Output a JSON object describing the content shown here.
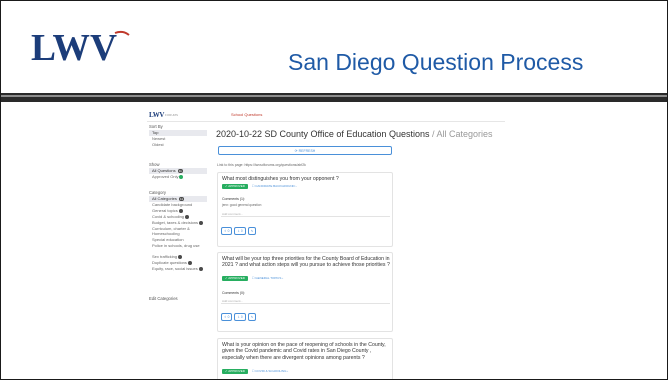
{
  "slide": {
    "title": "San Diego Question Process",
    "logo_text": "LWV"
  },
  "screenshot": {
    "topbar": {
      "logo": "LWV",
      "logo_sub": "FORUMS",
      "link": "School Questions"
    },
    "sidebar": {
      "sort_by_label": "Sort By",
      "sort_options": [
        "Top",
        "Newest",
        "Oldest"
      ],
      "show_label": "Show",
      "show_all": "All Questions",
      "show_all_count": "11",
      "show_approved": "Approved Only",
      "category_label": "Category",
      "categories": [
        "All Categories",
        "Candidate background",
        "General topics",
        "Covid & schooling",
        "Budget, taxes & decisions",
        "Curriculum, charter & Homeschooling",
        "Special education",
        "Police in schools, drug use",
        "Sex trafficking",
        "Duplicate questions",
        "Equity, race, social issues"
      ],
      "all_categories_count": "11",
      "edit_categories": "Edit Categories"
    },
    "main": {
      "title": "2020-10-22 SD County Office of Education Questions",
      "title_separator": " / ",
      "title_category": "All Categories",
      "refresh_label": "REFRESH",
      "link_label": "Link to this page:",
      "link_url": "https://lwvsdforums.org/questions/abf2k",
      "cards": [
        {
          "question": "What most distinguishes you from your opponent ?",
          "status": "APPROVED",
          "category": "CANDIDATE BACKGROUND",
          "comments_label": "Comments (1):",
          "comment": "jenn: good general question",
          "comment_placeholder": "Add comment...",
          "up_count": "0",
          "down_count": "0"
        },
        {
          "question": "What will be your top three priorities for the County Board of Education in 2021 ? and what action steps will you pursue to achieve those priorities ?",
          "status": "APPROVED",
          "category": "GENERAL TOPICS",
          "comments_label": "Comments (0):",
          "comment_placeholder": "Add comment...",
          "up_count": "0",
          "down_count": "0"
        },
        {
          "question": "What is your opinion on the pace of reopening of schools in the County, given the Covid pandemic and Covid rates in San Diego County , especially when there are divergent opinions among parents ?",
          "status": "APPROVED",
          "category": "COVID & SCHOOLING"
        }
      ]
    }
  },
  "colors": {
    "title_blue": "#1f5aa6",
    "approved_green": "#27ae60",
    "link_blue": "#4a90d9",
    "logo_navy": "#1c3d7a"
  }
}
